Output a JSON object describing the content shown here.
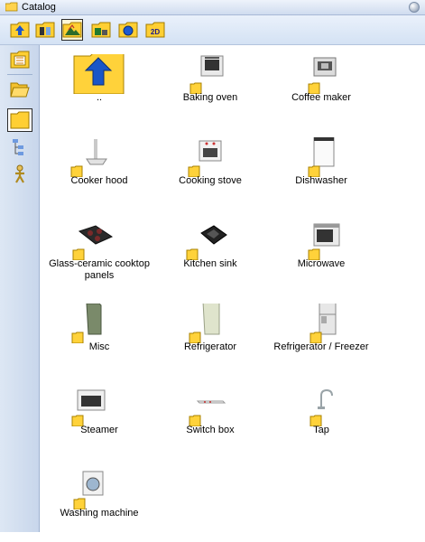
{
  "window": {
    "title": "Catalog"
  },
  "toolbar": {
    "buttons": [
      {
        "name": "up-folder-icon"
      },
      {
        "name": "catalog-view-icon"
      },
      {
        "name": "landscape-icon"
      },
      {
        "name": "furniture-folder-icon"
      },
      {
        "name": "globe-icon"
      },
      {
        "name": "2d-view-icon",
        "text": "2D"
      }
    ]
  },
  "sidebar": {
    "buttons": [
      {
        "name": "calendar-icon"
      },
      {
        "name": "open-folder-icon"
      },
      {
        "name": "folder-icon"
      },
      {
        "name": "tree-view-icon"
      },
      {
        "name": "person-icon"
      }
    ]
  },
  "items": [
    {
      "label": ".."
    },
    {
      "label": "Baking oven"
    },
    {
      "label": "Coffee maker"
    },
    {
      "label": "Cooker hood"
    },
    {
      "label": "Cooking stove"
    },
    {
      "label": "Dishwasher"
    },
    {
      "label": "Glass-ceramic cooktop panels"
    },
    {
      "label": "Kitchen sink"
    },
    {
      "label": "Microwave"
    },
    {
      "label": "Misc"
    },
    {
      "label": "Refrigerator"
    },
    {
      "label": "Refrigerator / Freezer"
    },
    {
      "label": "Steamer"
    },
    {
      "label": "Switch box"
    },
    {
      "label": "Tap"
    },
    {
      "label": "Washing machine"
    }
  ]
}
